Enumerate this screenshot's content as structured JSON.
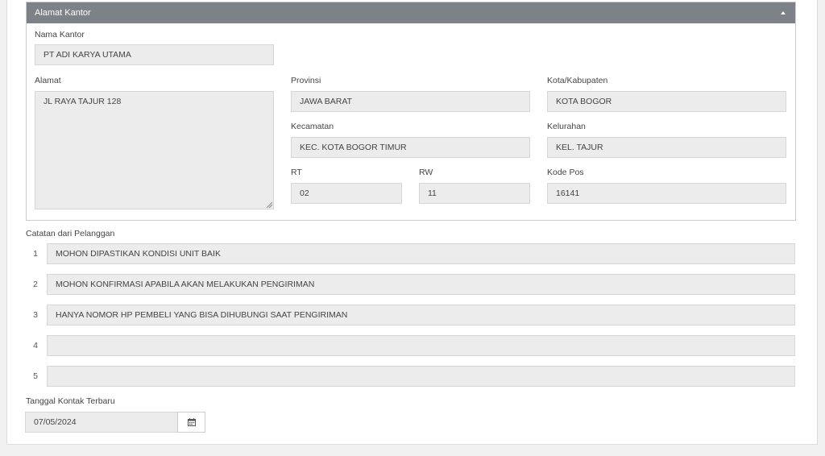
{
  "panel": {
    "title": "Alamat Kantor"
  },
  "nama_kantor": {
    "label": "Nama Kantor",
    "value": "PT ADI KARYA UTAMA"
  },
  "alamat": {
    "label": "Alamat",
    "value": "JL RAYA TAJUR 128"
  },
  "provinsi": {
    "label": "Provinsi",
    "value": "JAWA BARAT"
  },
  "kota": {
    "label": "Kota/Kabupaten",
    "value": "KOTA BOGOR"
  },
  "kecamatan": {
    "label": "Kecamatan",
    "value": "KEC. KOTA BOGOR TIMUR"
  },
  "kelurahan": {
    "label": "Kelurahan",
    "value": "KEL. TAJUR"
  },
  "rt": {
    "label": "RT",
    "value": "02"
  },
  "rw": {
    "label": "RW",
    "value": "11"
  },
  "kode_pos": {
    "label": "Kode Pos",
    "value": "16141"
  },
  "catatan": {
    "label": "Catatan dari Pelanggan",
    "items": [
      {
        "num": "1",
        "text": "MOHON DIPASTIKAN KONDISI UNIT BAIK"
      },
      {
        "num": "2",
        "text": "MOHON KONFIRMASI APABILA AKAN MELAKUKAN PENGIRIMAN"
      },
      {
        "num": "3",
        "text": "HANYA NOMOR HP PEMBELI YANG BISA DIHUBUNGI SAAT PENGIRIMAN"
      },
      {
        "num": "4",
        "text": ""
      },
      {
        "num": "5",
        "text": ""
      }
    ]
  },
  "tanggal": {
    "label": "Tanggal Kontak Terbaru",
    "value": "07/05/2024",
    "icon": "calendar-icon"
  }
}
